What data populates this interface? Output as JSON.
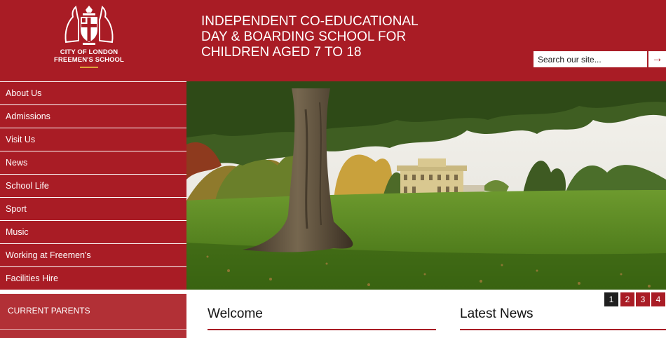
{
  "header": {
    "logo_line1": "CITY OF LONDON",
    "logo_line2": "FREEMEN'S SCHOOL",
    "tagline": [
      "INDEPENDENT CO-EDUCATIONAL",
      "DAY & BOARDING SCHOOL FOR",
      "CHILDREN AGED 7 TO 18"
    ],
    "search_placeholder": "Search our site...",
    "search_go": "→"
  },
  "nav": {
    "items": [
      "About Us",
      "Admissions",
      "Visit Us",
      "News",
      "School Life",
      "Sport",
      "Music",
      "Working at Freemen's",
      "Facilities Hire"
    ]
  },
  "parents": {
    "label": "CURRENT PARENTS"
  },
  "slider": {
    "pages": [
      "1",
      "2",
      "3",
      "4"
    ],
    "active": "1"
  },
  "content": {
    "welcome_title": "Welcome",
    "news_title": "Latest News"
  },
  "colors": {
    "brand_red": "#a91c25",
    "parents_red": "#b23036",
    "pager_active": "#1f1f1f",
    "logo_accent": "#e0a33a"
  }
}
